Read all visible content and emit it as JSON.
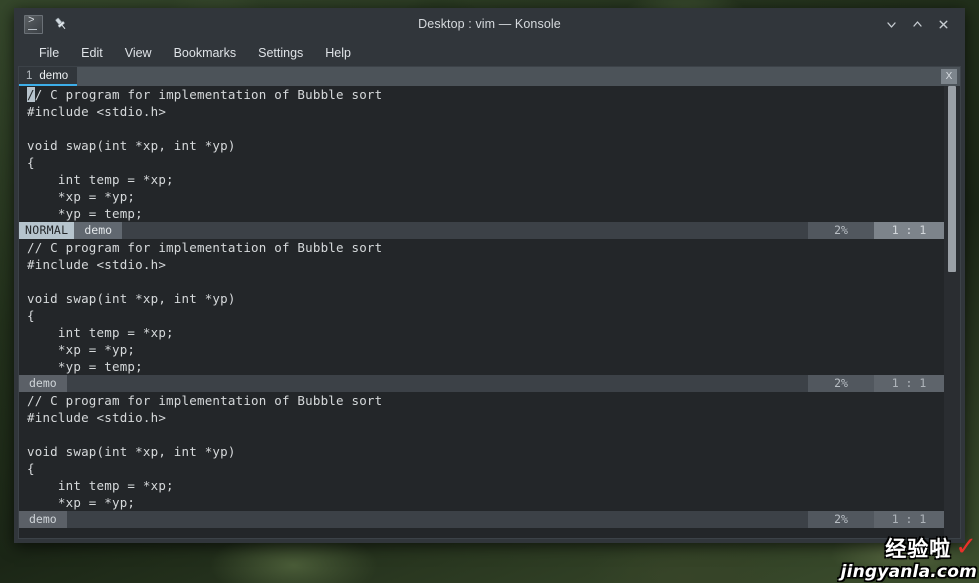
{
  "window": {
    "title": "Desktop : vim — Konsole",
    "app_icon": "konsole-icon",
    "pin_icon": "pin-icon",
    "controls": {
      "minimize": "∨",
      "maximize": "∧",
      "close": "✕"
    }
  },
  "menubar": {
    "items": [
      {
        "label": "File"
      },
      {
        "label": "Edit"
      },
      {
        "label": "View"
      },
      {
        "label": "Bookmarks"
      },
      {
        "label": "Settings"
      },
      {
        "label": "Help"
      }
    ]
  },
  "tabbar": {
    "tabs": [
      {
        "number": "1",
        "label": "demo"
      }
    ],
    "close_label": "X"
  },
  "scrollbar": {
    "orientation": "vertical"
  },
  "panes": [
    {
      "id": "pane-top",
      "active": true,
      "cursor": {
        "line": 1,
        "col": 1,
        "char": "/"
      },
      "lines": [
        "// C program for implementation of Bubble sort",
        "#include <stdio.h>",
        "",
        "void swap(int *xp, int *yp)",
        "{",
        "    int temp = *xp;",
        "    *xp = *yp;",
        "    *yp = temp;"
      ],
      "statusline": {
        "mode": "NORMAL",
        "file": "demo",
        "percent": "2%",
        "position": "1 : 1"
      }
    },
    {
      "id": "pane-middle",
      "active": false,
      "lines": [
        "// C program for implementation of Bubble sort",
        "#include <stdio.h>",
        "",
        "void swap(int *xp, int *yp)",
        "{",
        "    int temp = *xp;",
        "    *xp = *yp;",
        "    *yp = temp;"
      ],
      "statusline": {
        "mode": "",
        "file": "demo",
        "percent": "2%",
        "position": "1 : 1"
      }
    },
    {
      "id": "pane-bottom",
      "active": false,
      "lines": [
        "// C program for implementation of Bubble sort",
        "#include <stdio.h>",
        "",
        "void swap(int *xp, int *yp)",
        "{",
        "    int temp = *xp;",
        "    *xp = *yp;"
      ],
      "statusline": {
        "mode": "",
        "file": "demo",
        "percent": "2%",
        "position": "1 : 1"
      }
    }
  ],
  "watermark": {
    "brand_cn": "经验啦",
    "check": "✓",
    "url": "jingyanla.com"
  },
  "colors": {
    "window_chrome": "#31363b",
    "terminal_bg": "#232629",
    "text": "#d6d9db",
    "accent": "#3daee9",
    "status_mode_bg": "#b6c4cd",
    "watermark_red": "#e8302a"
  }
}
